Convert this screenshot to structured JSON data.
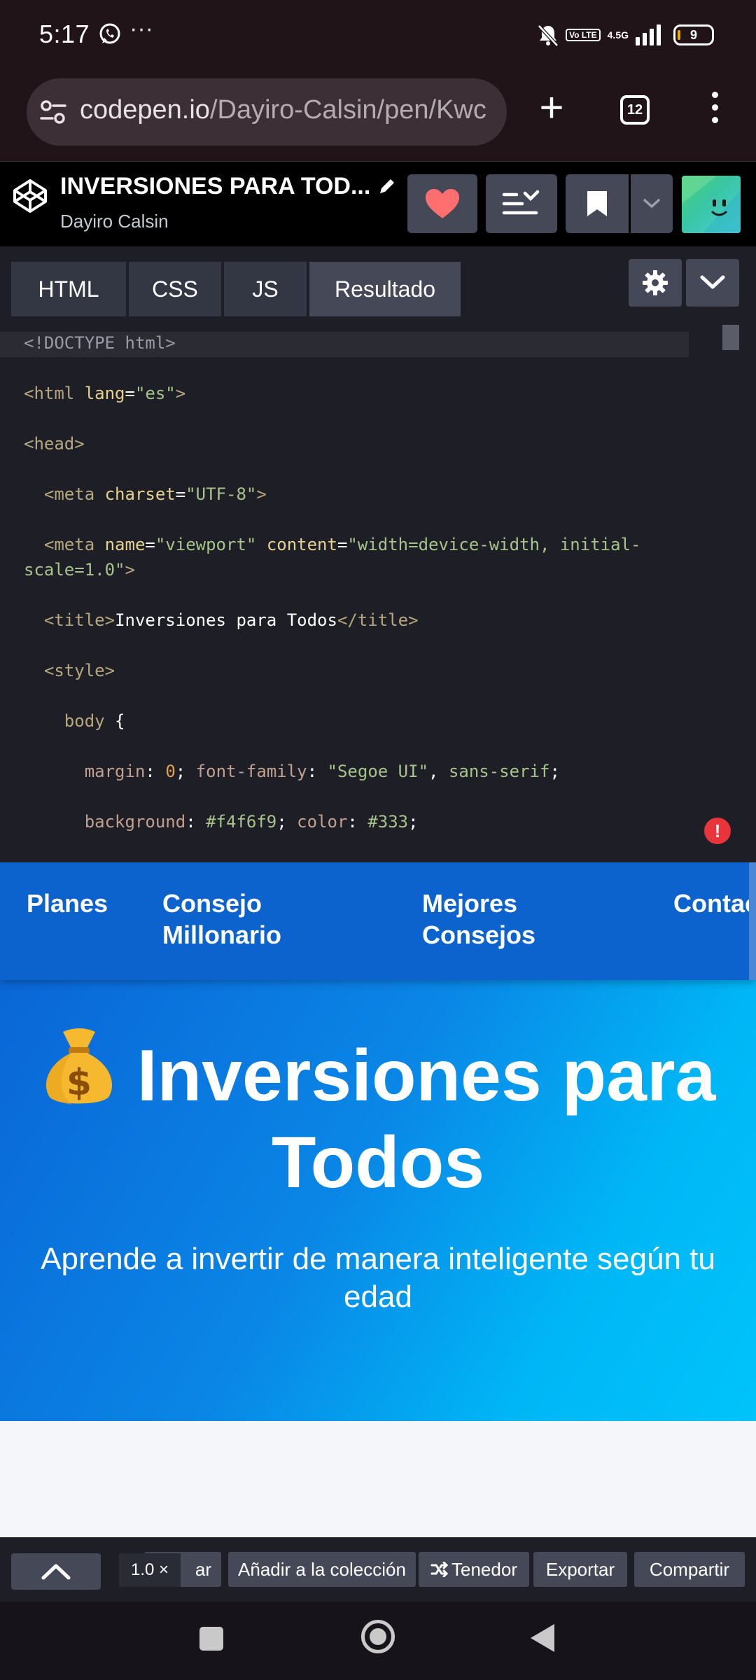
{
  "status": {
    "time": "5:17",
    "overflow": "···",
    "volte": "Vo LTE",
    "network": "4.5G",
    "battery": "9"
  },
  "browser": {
    "url_host": "codepen.io",
    "url_path": "/Dayiro-Calsin/pen/Kwc",
    "tab_count": "12"
  },
  "pen": {
    "title": "INVERSIONES PARA TOD...",
    "author": "Dayiro Calsin",
    "accent": "#ff5f6b"
  },
  "tabs": [
    "HTML",
    "CSS",
    "JS",
    "Resultado"
  ],
  "code": {
    "l1": "<!DOCTYPE html>",
    "l2_tag_open": "<html ",
    "l2_attr": "lang",
    "l2_eq": "=",
    "l2_val": "\"es\"",
    "l2_close": ">",
    "l3": "<head>",
    "l4_tag": "<meta ",
    "l4_attr": "charset",
    "l4_val": "\"UTF-8\"",
    "l4_close": ">",
    "l5_tag": "<meta ",
    "l5_attr1": "name",
    "l5_val1": "\"viewport\"",
    "l5_attr2": "content",
    "l5_val2a": "\"width=device-width, initial-",
    "l5_val2b": "scale=1.0\"",
    "l5_close": ">",
    "l6_open": "<title>",
    "l6_text": "Inversiones para Todos",
    "l6_close": "</title>",
    "l7": "<style>",
    "l8_sel": "body",
    "l8_brace": " {",
    "l9_prop1": "margin",
    "l9_val1": "0",
    "l9_prop2": "font-family",
    "l9_val2": "\"Segoe UI\"",
    "l9_val3": "sans-serif",
    "l10_prop1": "background",
    "l10_val1": "#f4f6f9",
    "l10_prop2": "color",
    "l10_val2": "#333"
  },
  "error_badge": "!",
  "preview": {
    "nav": [
      "Planes",
      "Consejo\nMillonario",
      "Mejores\nConsejos",
      "Contac"
    ],
    "nav_color": "#0d63cd",
    "hero_title": "Inversiones para Todos",
    "hero_subtitle": "Aprende a invertir de manera inteligente según tu edad"
  },
  "footer": {
    "zoom": "1.0 ×",
    "partial_label": "ar",
    "add_collection": "Añadir a la colección",
    "fork": "Tenedor",
    "export": "Exportar",
    "share": "Compartir"
  }
}
